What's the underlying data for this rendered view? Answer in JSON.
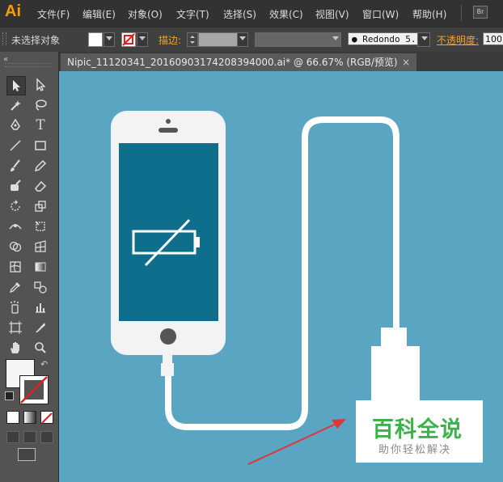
{
  "app": {
    "logo": "Ai",
    "br_button": "Br"
  },
  "menu": {
    "items": [
      "文件(F)",
      "编辑(E)",
      "对象(O)",
      "文字(T)",
      "选择(S)",
      "效果(C)",
      "视图(V)",
      "窗口(W)",
      "帮助(H)"
    ]
  },
  "control_bar": {
    "selection_status": "未选择对象",
    "stroke_label": "描边:",
    "font_name": "Redondo 5...",
    "opacity_label": "不透明度:",
    "opacity_value": "100"
  },
  "document": {
    "tab_title": "Nipic_11120341_20160903174208394000.ai* @ 66.67% (RGB/预览)"
  },
  "watermark": {
    "title": "百科全说",
    "subtitle": "助你轻松解决"
  },
  "colors": {
    "canvas_bg": "#5aa5c2",
    "phone_body": "#f3f3f3",
    "phone_screen": "#0f6e8c",
    "cable": "#ffffff",
    "arrow": "#e0353a",
    "watermark_title": "#3db24a",
    "accent_orange": "#ff9a00"
  },
  "icons": {
    "battery": "battery-empty-slashed-icon"
  }
}
